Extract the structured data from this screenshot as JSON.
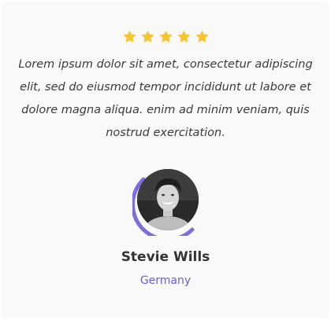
{
  "testimonial": {
    "rating": 5,
    "rating_max": 5,
    "star_color": "#f7c331",
    "star_icon": "star-icon",
    "quote": "Lorem ipsum dolor sit amet, consectetur adipiscing elit, sed do eiusmod tempor incididunt ut labore et dolore magna aliqua. enim ad minim veniam, quis nostrud exercitation.",
    "author_name": "Stevie Wills",
    "author_location": "Germany",
    "accent_color": "#7b6fe0",
    "location_color": "#6b5fd3"
  }
}
